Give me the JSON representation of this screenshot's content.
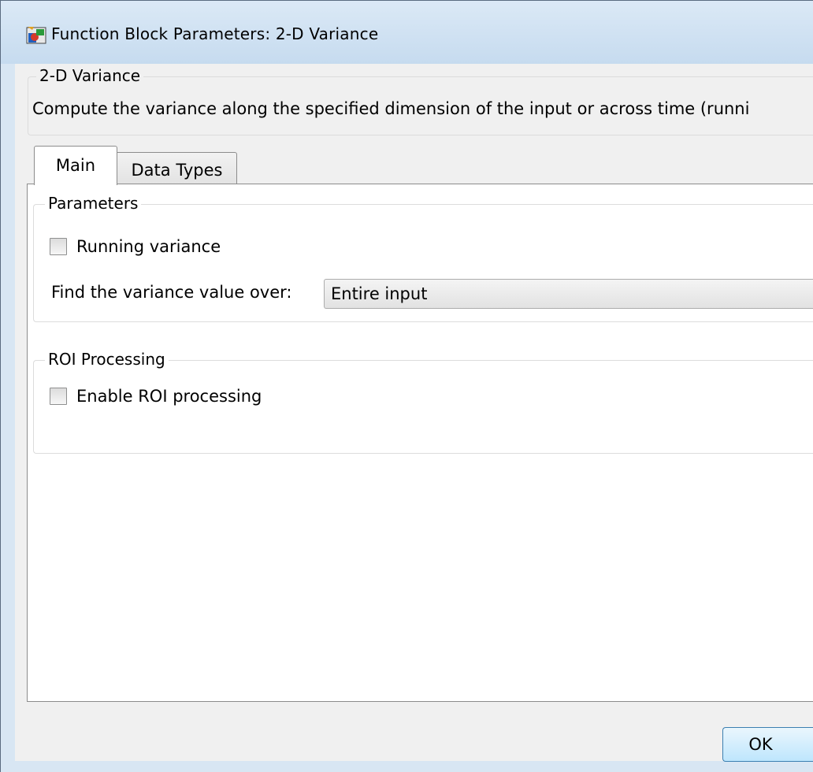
{
  "window": {
    "title": "Function Block Parameters: 2-D Variance"
  },
  "description": {
    "group_label": "2-D Variance",
    "text": "Compute the variance along the specified dimension of the input or across time (runni"
  },
  "tabs": [
    {
      "label": "Main",
      "selected": true
    },
    {
      "label": "Data Types",
      "selected": false
    }
  ],
  "parameters": {
    "group_label": "Parameters",
    "running_variance_label": "Running variance",
    "running_variance_checked": false,
    "find_over_label": "Find the variance value over:",
    "find_over_value": "Entire input"
  },
  "roi": {
    "group_label": "ROI Processing",
    "enable_label": "Enable ROI processing",
    "enable_checked": false
  },
  "buttons": {
    "ok_label": "OK"
  },
  "colors": {
    "title_bg": "#cfe0f2",
    "ok_border": "#3c7fb1"
  }
}
